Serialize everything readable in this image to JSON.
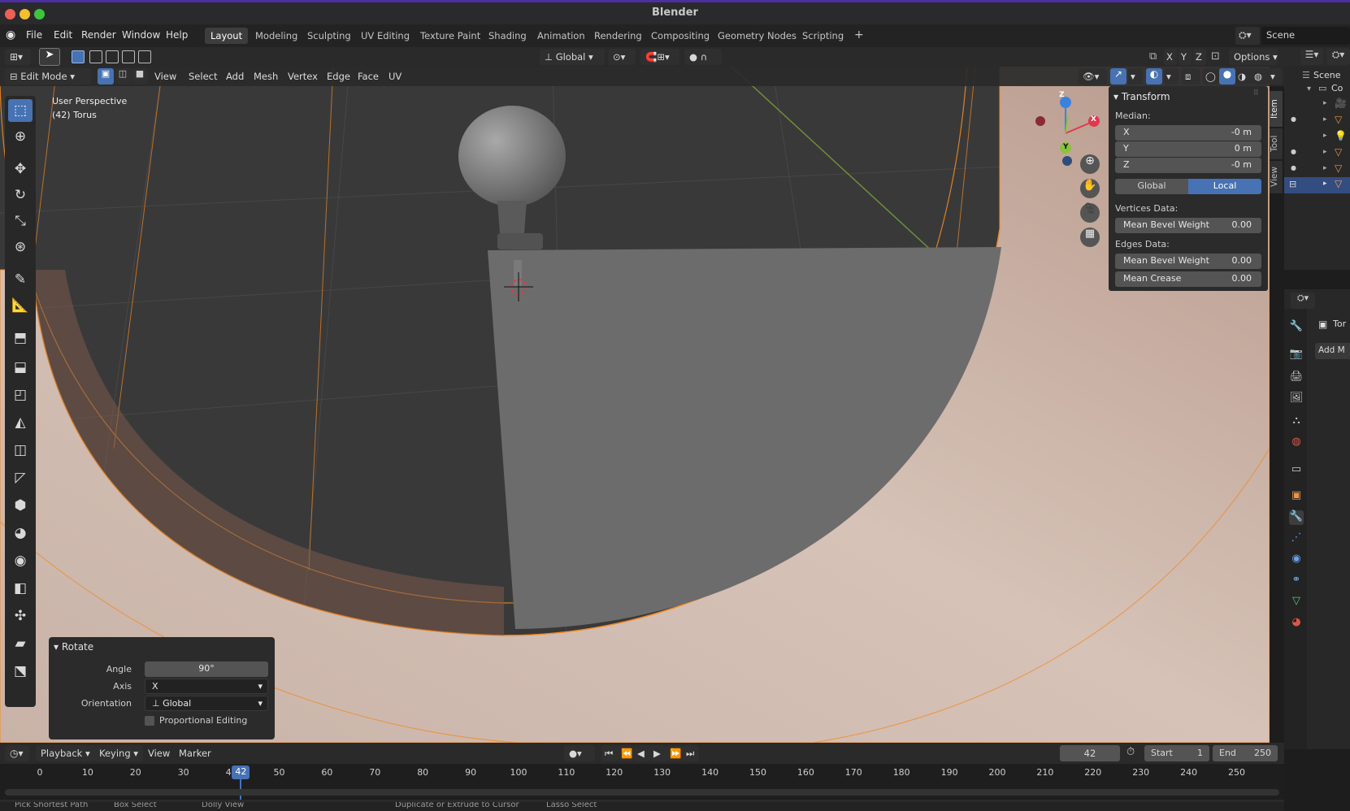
{
  "window": {
    "title": "Blender"
  },
  "topbar": {
    "menus": [
      "File",
      "Edit",
      "Render",
      "Window",
      "Help"
    ],
    "workspaces": [
      "Layout",
      "Modeling",
      "Sculpting",
      "UV Editing",
      "Texture Paint",
      "Shading",
      "Animation",
      "Rendering",
      "Compositing",
      "Geometry Nodes",
      "Scripting"
    ],
    "active_workspace": "Layout",
    "add_workspace": "+",
    "scene": "Scene"
  },
  "tool_header": {
    "orientation": "Global",
    "axes": [
      "X",
      "Y",
      "Z"
    ],
    "options": "Options"
  },
  "mode_header": {
    "mode": "Edit Mode",
    "menus": [
      "View",
      "Select",
      "Add",
      "Mesh",
      "Vertex",
      "Edge",
      "Face",
      "UV"
    ]
  },
  "viewport": {
    "perspective": "User Perspective",
    "object_info": "(42) Torus",
    "gizmo_axes": {
      "x": "X",
      "y": "Y",
      "z": "Z"
    }
  },
  "npanel": {
    "title": "Transform",
    "median_label": "Median:",
    "x_label": "X",
    "x_value": "-0 m",
    "y_label": "Y",
    "y_value": "0 m",
    "z_label": "Z",
    "z_value": "-0 m",
    "global_btn": "Global",
    "local_btn": "Local",
    "vertices_label": "Vertices Data:",
    "v_bevel_label": "Mean Bevel Weight",
    "v_bevel_value": "0.00",
    "edges_label": "Edges Data:",
    "e_bevel_label": "Mean Bevel Weight",
    "e_bevel_value": "0.00",
    "e_crease_label": "Mean Crease",
    "e_crease_value": "0.00",
    "tabs": [
      "Item",
      "Tool",
      "View"
    ]
  },
  "outliner": {
    "scene_label": "Scene",
    "collection_label": "Co"
  },
  "properties": {
    "object_label": "Tor",
    "add_modifier": "Add M"
  },
  "rotate_panel": {
    "title": "Rotate",
    "angle_label": "Angle",
    "angle_value": "90°",
    "axis_label": "Axis",
    "axis_value": "X",
    "orientation_label": "Orientation",
    "orientation_value": "Global",
    "proportional_label": "Proportional Editing"
  },
  "timeline": {
    "menus": [
      "Playback",
      "Keying",
      "View",
      "Marker"
    ],
    "current_frame": "42",
    "start_label": "Start",
    "start_value": "1",
    "end_label": "End",
    "end_value": "250",
    "ticks": [
      "0",
      "10",
      "20",
      "30",
      "40",
      "50",
      "60",
      "70",
      "80",
      "90",
      "100",
      "110",
      "120",
      "130",
      "140",
      "150",
      "160",
      "170",
      "180",
      "190",
      "200",
      "210",
      "220",
      "230",
      "240",
      "250"
    ]
  },
  "statusbar": {
    "items": [
      "Pick Shortest Path",
      "Box Select",
      "Dolly View",
      "Duplicate or Extrude to Cursor",
      "Lasso Select"
    ]
  },
  "colors": {
    "accent": "#4772b3",
    "select_orange": "#f08a24",
    "x_axis": "#e0394d",
    "y_axis": "#8ac33b",
    "z_axis": "#3b82e0"
  }
}
